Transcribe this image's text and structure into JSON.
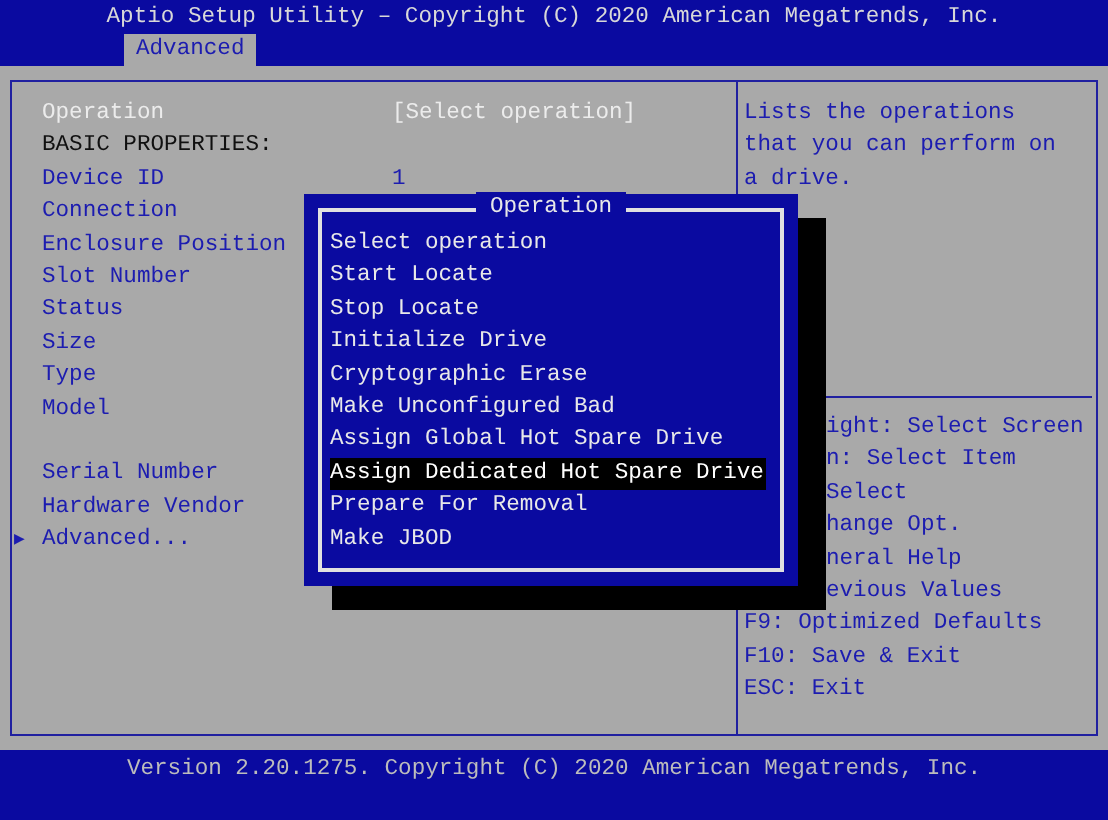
{
  "header": {
    "title": "Aptio Setup Utility – Copyright (C) 2020 American Megatrends, Inc.",
    "tabs": [
      {
        "label": "Advanced",
        "selected": true
      }
    ]
  },
  "settings": {
    "sections": [
      [
        {
          "kind": "option",
          "label": "Operation",
          "value": "[Select operation]",
          "selected": true
        },
        {
          "kind": "heading",
          "label": "BASIC PROPERTIES:"
        },
        {
          "kind": "info",
          "label": "Device ID",
          "value": "1"
        },
        {
          "kind": "info",
          "label": "Connection"
        },
        {
          "kind": "info",
          "label": "Enclosure Position"
        },
        {
          "kind": "info",
          "label": "Slot Number"
        },
        {
          "kind": "info",
          "label": "Status"
        },
        {
          "kind": "info",
          "label": "Size"
        },
        {
          "kind": "info",
          "label": "Type"
        },
        {
          "kind": "info",
          "label": "Model"
        }
      ],
      [
        {
          "kind": "info",
          "label": "Serial Number"
        },
        {
          "kind": "info",
          "label": "Hardware Vendor"
        },
        {
          "kind": "submenu",
          "label": "Advanced...",
          "marker": "▶"
        }
      ]
    ]
  },
  "help": {
    "description": [
      "Lists the operations",
      "that you can perform on",
      "a drive."
    ],
    "keys": [
      {
        "text": "ight: Select Screen",
        "covered": true
      },
      {
        "text": "n: Select Item",
        "covered": true
      },
      {
        "text": "Select",
        "covered": true
      },
      {
        "text": "hange Opt.",
        "covered": true
      },
      {
        "text": "neral Help",
        "covered": true
      },
      {
        "text": "evious Values",
        "covered": true
      },
      {
        "text": "F9: Optimized Defaults",
        "covered": false
      },
      {
        "text": "F10: Save & Exit",
        "covered": false
      },
      {
        "text": "ESC: Exit",
        "covered": false
      }
    ]
  },
  "popup": {
    "title": "Operation",
    "options": [
      {
        "label": "Select operation",
        "selected": false
      },
      {
        "label": "Start Locate",
        "selected": false
      },
      {
        "label": "Stop Locate",
        "selected": false
      },
      {
        "label": "Initialize Drive",
        "selected": false
      },
      {
        "label": "Cryptographic Erase",
        "selected": false
      },
      {
        "label": "Make Unconfigured Bad",
        "selected": false
      },
      {
        "label": "Assign Global Hot Spare Drive",
        "selected": false
      },
      {
        "label": "Assign Dedicated Hot Spare Drive",
        "selected": true
      },
      {
        "label": "Prepare For Removal",
        "selected": false
      },
      {
        "label": "Make JBOD",
        "selected": false
      }
    ]
  },
  "footer": {
    "text": "Version 2.20.1275. Copyright (C) 2020 American Megatrends, Inc."
  }
}
